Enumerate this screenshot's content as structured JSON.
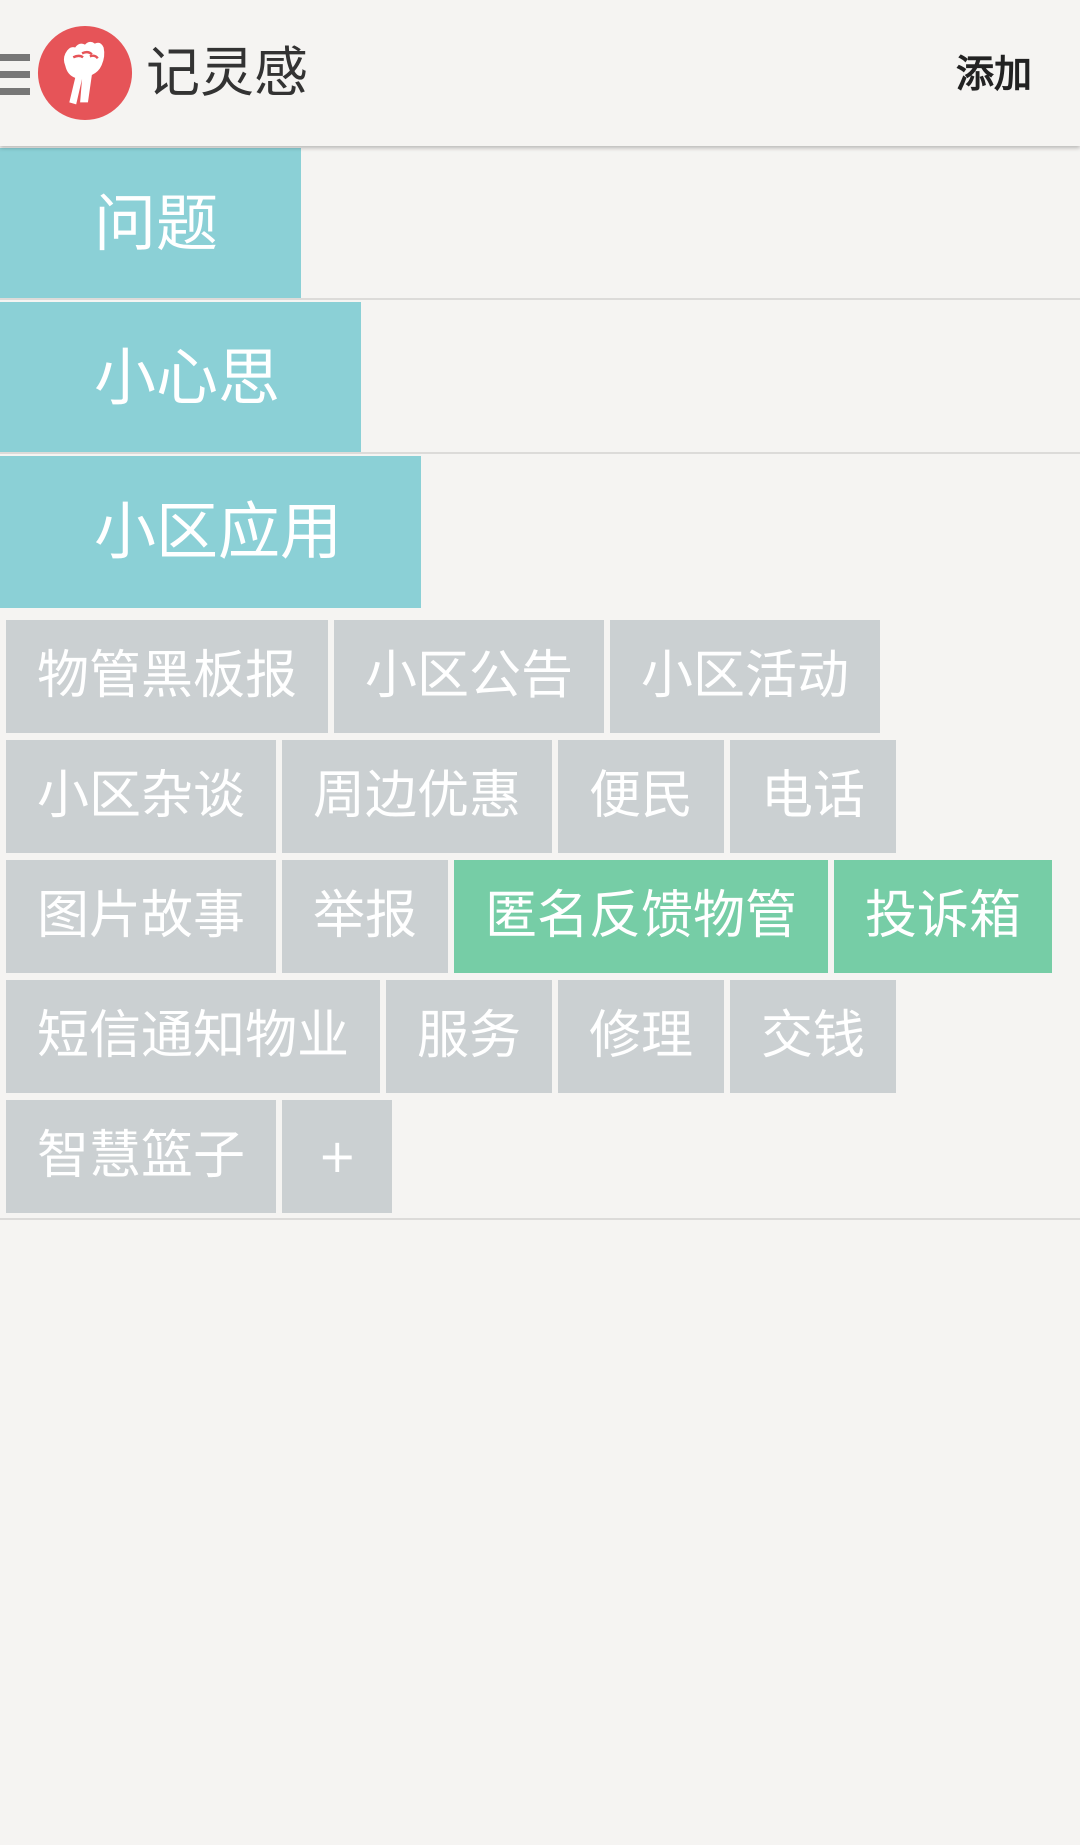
{
  "header": {
    "app_title": "记灵感",
    "add_label": "添加",
    "menu_icon": "hamburger-menu-icon",
    "logo_icon": "raised-fist-logo-icon"
  },
  "categories": [
    {
      "label": "问题"
    },
    {
      "label": "小心思"
    },
    {
      "label": "小区应用"
    }
  ],
  "tags": {
    "rows": [
      [
        {
          "label": "物管黑板报",
          "selected": false
        },
        {
          "label": "小区公告",
          "selected": false
        },
        {
          "label": "小区活动",
          "selected": false
        }
      ],
      [
        {
          "label": "小区杂谈",
          "selected": false
        },
        {
          "label": "周边优惠",
          "selected": false
        },
        {
          "label": "便民",
          "selected": false
        },
        {
          "label": "电话",
          "selected": false
        }
      ],
      [
        {
          "label": "图片故事",
          "selected": false
        },
        {
          "label": "举报",
          "selected": false
        },
        {
          "label": "匿名反馈物管",
          "selected": true
        },
        {
          "label": "投诉箱",
          "selected": true
        }
      ],
      [
        {
          "label": "短信通知物业",
          "selected": false
        },
        {
          "label": "服务",
          "selected": false
        },
        {
          "label": "修理",
          "selected": false
        },
        {
          "label": "交钱",
          "selected": false
        }
      ],
      [
        {
          "label": "智慧篮子",
          "selected": false
        },
        {
          "label": "+",
          "selected": false
        }
      ]
    ]
  },
  "colors": {
    "background": "#f5f4f2",
    "category_accent": "#8bd0d6",
    "tag_default": "#cbd0d2",
    "tag_selected": "#76cda6",
    "logo_red": "#e65458"
  }
}
